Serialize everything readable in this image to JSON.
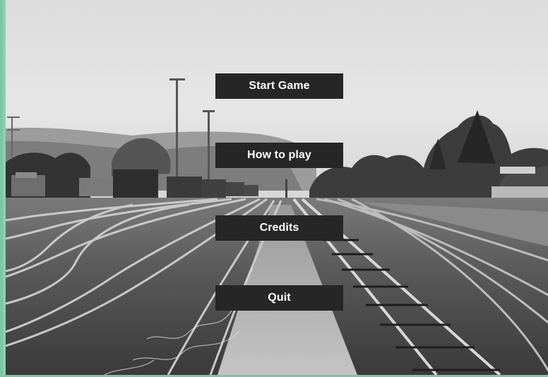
{
  "background": {
    "scene": "railway-yard-photo",
    "tone": "grayscale"
  },
  "colors": {
    "button_bg": "#262626",
    "button_text": "#ffffff",
    "window_border": "#7cc7a3"
  },
  "menu": {
    "start_label": "Start Game",
    "how_to_play_label": "How to play",
    "credits_label": "Credits",
    "quit_label": "Quit"
  }
}
